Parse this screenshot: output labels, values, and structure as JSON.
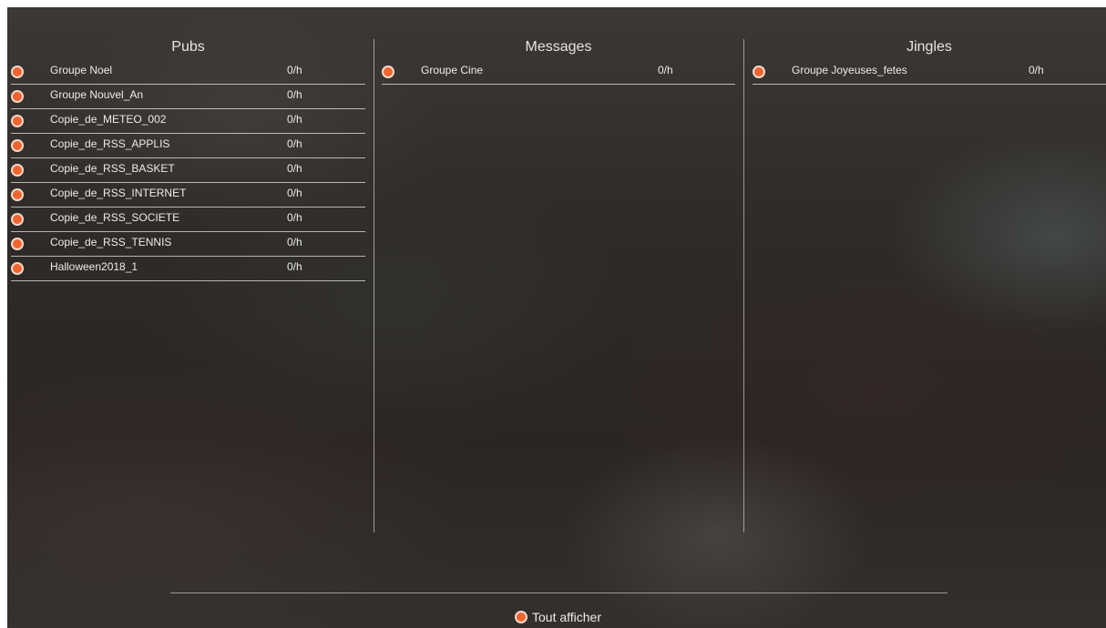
{
  "columns": [
    {
      "title": "Pubs",
      "items": [
        {
          "name": "Groupe Noel",
          "rate": "0/h"
        },
        {
          "name": "Groupe Nouvel_An",
          "rate": "0/h"
        },
        {
          "name": "Copie_de_METEO_002",
          "rate": "0/h"
        },
        {
          "name": "Copie_de_RSS_APPLIS",
          "rate": "0/h"
        },
        {
          "name": "Copie_de_RSS_BASKET",
          "rate": "0/h"
        },
        {
          "name": "Copie_de_RSS_INTERNET",
          "rate": "0/h"
        },
        {
          "name": "Copie_de_RSS_SOCIETE",
          "rate": "0/h"
        },
        {
          "name": "Copie_de_RSS_TENNIS",
          "rate": "0/h"
        },
        {
          "name": "Halloween2018_1",
          "rate": "0/h"
        }
      ]
    },
    {
      "title": "Messages",
      "items": [
        {
          "name": "Groupe Cine",
          "rate": "0/h"
        }
      ]
    },
    {
      "title": "Jingles",
      "items": [
        {
          "name": "Groupe Joyeuses_fetes",
          "rate": "0/h"
        }
      ]
    }
  ],
  "footer": {
    "show_all_label": "Tout afficher"
  },
  "icons": {
    "item_radio": "radio-icon",
    "show_all_radio": "radio-icon"
  },
  "colors": {
    "accent": "#f06430",
    "text": "#ececec",
    "divider": "#e1e1e1"
  }
}
